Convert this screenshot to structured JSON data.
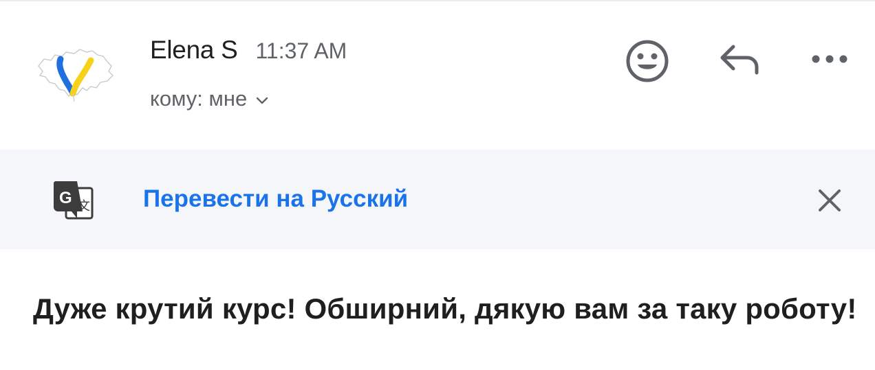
{
  "message": {
    "sender_name": "Elena S",
    "time": "11:37 AM",
    "recipient": "кому: мне",
    "body": "Дуже крутий курс! Обширний, дякую вам за таку роботу!"
  },
  "actions": {
    "emoji_icon": "emoji-reaction-icon",
    "reply_icon": "reply-icon",
    "more_icon": "more-horizontal-icon"
  },
  "translate": {
    "icon": "google-translate-icon",
    "label": "Перевести на Русский",
    "close_icon": "close-icon"
  },
  "colors": {
    "link_blue": "#1a73e8",
    "ukraine_blue": "#1f6fe0",
    "ukraine_yellow": "#f6d21a",
    "banner_bg": "#f5f6fa",
    "icon_gray": "#5f6368"
  }
}
